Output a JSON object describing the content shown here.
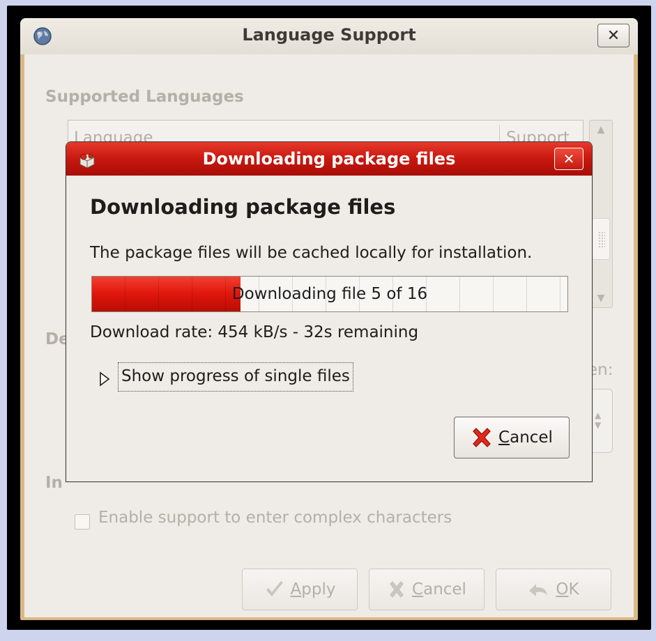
{
  "main_window": {
    "title": "Language Support",
    "supported_languages_label": "Supported Languages",
    "table": {
      "columns": [
        "Language",
        "Support"
      ]
    },
    "default_language_label_partial": "De",
    "default_language_suffix_partial": "en:",
    "input_methods_label_partial": "In",
    "complex_characters_label": "Enable support to enter complex characters",
    "buttons": {
      "apply": {
        "mnemonic": "A",
        "rest": "pply"
      },
      "cancel": {
        "mnemonic": "C",
        "rest": "ancel"
      },
      "ok": {
        "mnemonic": "O",
        "rest": "K"
      }
    }
  },
  "dialog": {
    "title": "Downloading package files",
    "heading": "Downloading package files",
    "message": "The package files will be cached locally for installation.",
    "progress": {
      "fraction": 0.3125,
      "text": "Downloading file 5 of 16"
    },
    "rate_text": "Download rate: 454 kB/s - 32s remaining",
    "expander_label": "Show progress of single files",
    "cancel_button": {
      "mnemonic": "C",
      "rest": "ancel"
    }
  },
  "colors": {
    "dialog_titlebar": "#c8180f",
    "progress_fill": "#e0160b",
    "window_bg": "#efebe6"
  },
  "icons": {
    "main_window": "globe-icon",
    "dialog": "package-icon",
    "apply": "checkmark-icon",
    "cancel": "red-x-icon",
    "ok": "ok-arrow-icon"
  }
}
